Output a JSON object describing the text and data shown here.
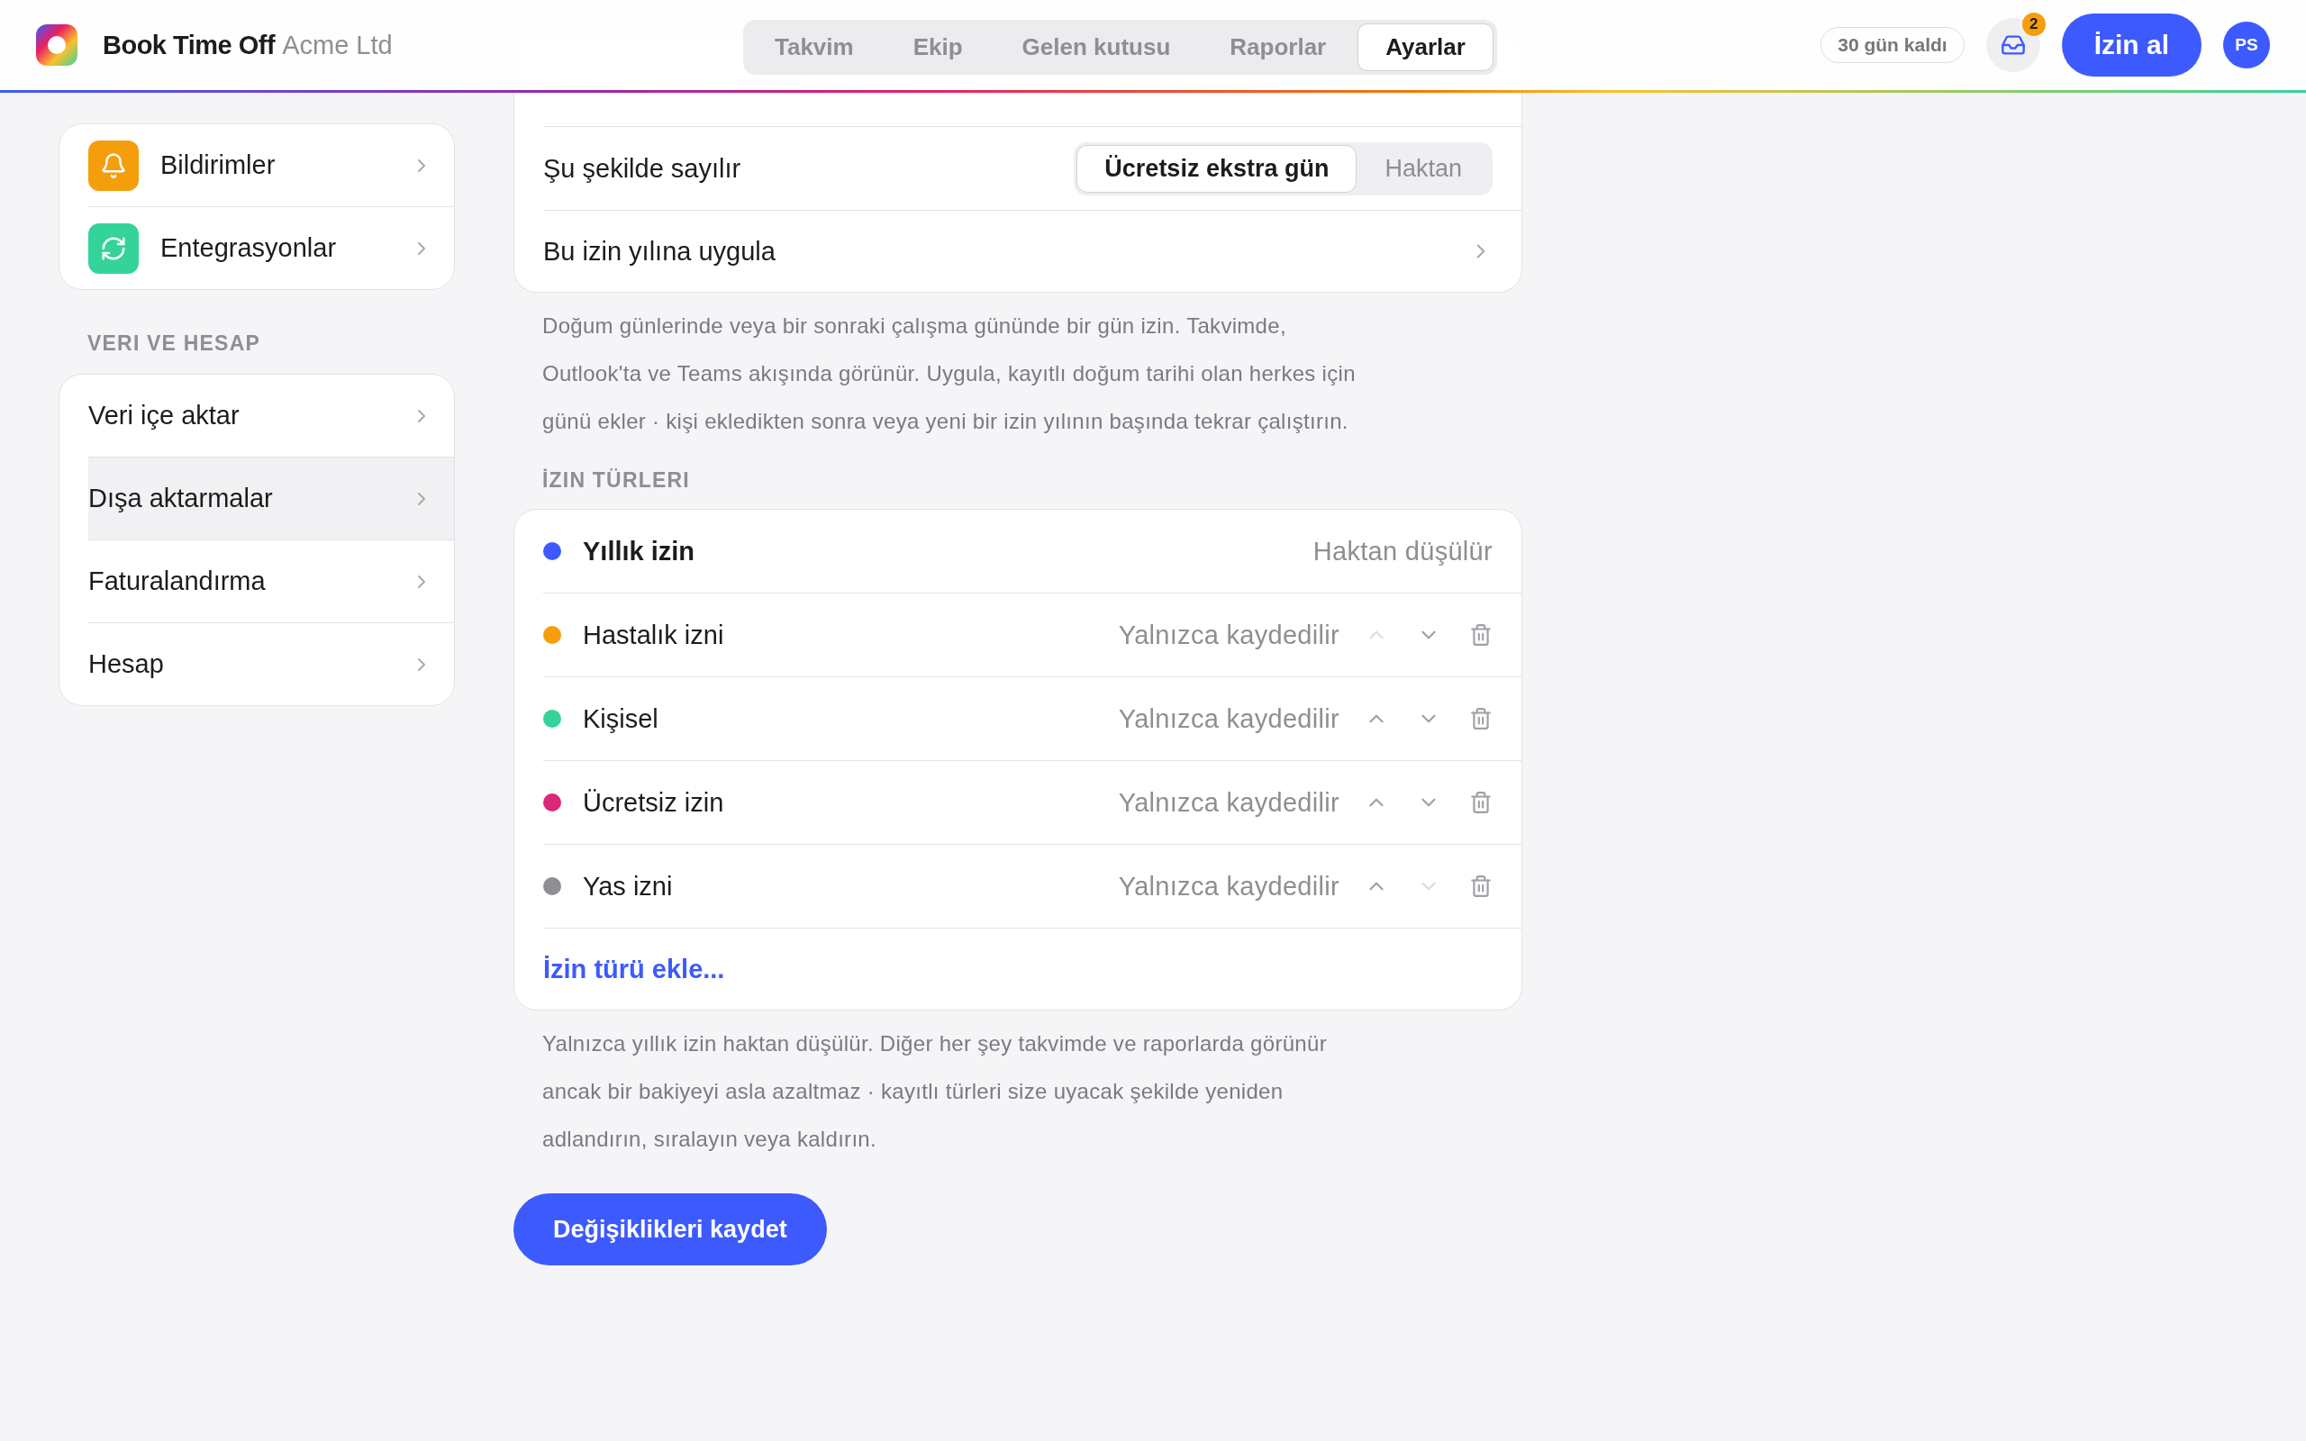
{
  "header": {
    "app_name": "Book Time Off",
    "org": "Acme Ltd",
    "tabs": [
      {
        "label": "Takvim",
        "selected": false
      },
      {
        "label": "Ekip",
        "selected": false
      },
      {
        "label": "Gelen kutusu",
        "selected": false
      },
      {
        "label": "Raporlar",
        "selected": false
      },
      {
        "label": "Ayarlar",
        "selected": true
      }
    ],
    "trial": "30 gün kaldı",
    "inbox_count": "2",
    "cta": "İzin al",
    "avatar": "PS"
  },
  "sidebar": {
    "groups": [
      {
        "items": [
          {
            "label": "Bildirimler",
            "color": "#f59e0b",
            "selected": false
          },
          {
            "label": "Entegrasyonlar",
            "color": "#34d399",
            "selected": false
          }
        ]
      },
      {
        "title": "VERI VE HESAP",
        "items": [
          {
            "label": "Veri içe aktar",
            "selected": false
          },
          {
            "label": "Dışa aktarmalar",
            "selected": true
          },
          {
            "label": "Faturalandırma",
            "selected": false
          },
          {
            "label": "Hesap",
            "selected": false
          }
        ]
      }
    ]
  },
  "birthday": {
    "count_as": {
      "label": "Şu şekilde sayılır",
      "options": [
        {
          "label": "Ücretsiz ekstra gün",
          "selected": true
        },
        {
          "label": "Haktan",
          "selected": false
        }
      ]
    },
    "apply": {
      "label": "Bu izin yılına uygula"
    },
    "note": "Doğum günlerinde veya bir sonraki çalışma gününde bir gün izin. Takvimde, Outlook'ta ve Teams akışında görünür. Uygula, kayıtlı doğum tarihi olan herkes için günü ekler · kişi ekledikten sonra veya yeni bir izin yılının başında tekrar çalıştırın."
  },
  "leave_types": {
    "title": "İZIN TÜRLERI",
    "items": [
      {
        "name": "Yıllık izin",
        "status": "Haktan düşülür",
        "color": "#3d5afe",
        "kind": "deducted"
      },
      {
        "name": "Hastalık izni",
        "status": "Yalnızca kaydedilir",
        "color": "#f59e0b",
        "kind": "tracked",
        "up_disabled": true,
        "down_disabled": false
      },
      {
        "name": "Kişisel",
        "status": "Yalnızca kaydedilir",
        "color": "#34d399",
        "kind": "tracked",
        "up_disabled": false,
        "down_disabled": false
      },
      {
        "name": "Ücretsiz izin",
        "status": "Yalnızca kaydedilir",
        "color": "#db2777",
        "kind": "tracked",
        "up_disabled": false,
        "down_disabled": false
      },
      {
        "name": "Yas izni",
        "status": "Yalnızca kaydedilir",
        "color": "#8e8e93",
        "kind": "tracked",
        "up_disabled": false,
        "down_disabled": true
      }
    ],
    "add": "İzin türü ekle...",
    "note": "Yalnızca yıllık izin haktan düşülür. Diğer her şey takvimde ve raporlarda görünür ancak bir bakiyeyi asla azaltmaz · kayıtlı türleri size uyacak şekilde yeniden adlandırın, sıralayın veya kaldırın."
  },
  "save": "Değişiklikleri kaydet"
}
